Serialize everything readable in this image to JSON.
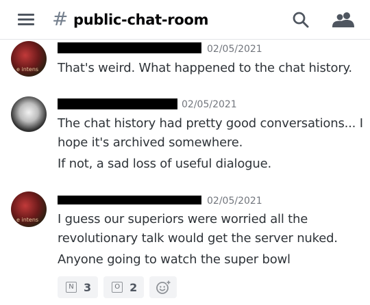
{
  "header": {
    "channel_hash": "#",
    "channel_name": "public-chat-room"
  },
  "messages": [
    {
      "author": "",
      "timestamp": "02/05/2021",
      "lines": [
        "That's weird. What happened to the chat history."
      ]
    },
    {
      "author": "",
      "timestamp": "02/05/2021",
      "lines": [
        "The chat history had pretty good conversations... I",
        "hope it's archived somewhere.",
        "If not, a sad loss of useful dialogue."
      ]
    },
    {
      "author": "",
      "timestamp": "02/05/2021",
      "lines": [
        "I guess our superiors were worried all the",
        "revolutionary talk would get the server nuked.",
        "Anyone going to watch the super bowl"
      ]
    }
  ],
  "reactions": [
    {
      "emoji": "N",
      "count": "3"
    },
    {
      "emoji": "O",
      "count": "2"
    }
  ],
  "icons": {
    "menu": "hamburger-menu-icon",
    "search": "search-icon",
    "members": "members-icon",
    "add_reaction": "add-reaction-icon"
  },
  "colors": {
    "accent_username": "#a06fd0",
    "timestamp": "#72767d",
    "text": "#2e3338"
  }
}
